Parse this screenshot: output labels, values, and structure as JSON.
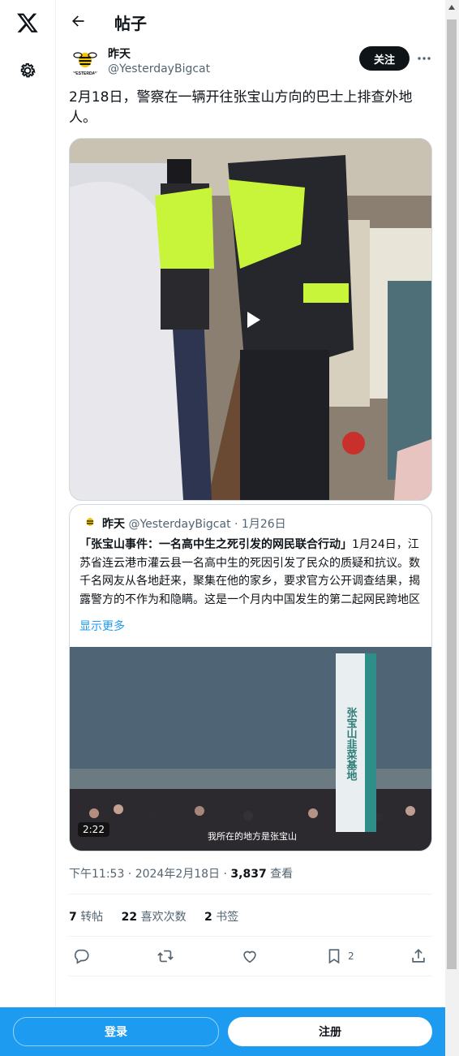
{
  "nav": {
    "logo_icon": "x-logo-icon",
    "settings_icon": "gear-icon"
  },
  "header": {
    "title": "帖子",
    "back_icon": "arrow-left-icon"
  },
  "author": {
    "name": "昨天",
    "handle": "@YesterdayBigcat",
    "avatar_label": "YESTERDAY",
    "follow_label": "关注"
  },
  "tweet": {
    "text": "2月18日，警察在一辆开往张宝山方向的巴士上排查外地人。",
    "timestamp": "下午11:53 · 2024年2月18日 · ",
    "views_count": "3,837",
    "views_label": " 查看"
  },
  "quote": {
    "name": "昨天",
    "meta": "@YesterdayBigcat · 1月26日",
    "title": "「张宝山事件：一名高中生之死引发的网民联合行动」",
    "body": "1月24日，江苏省连云港市灌云县一名高中生的死因引发了民众的质疑和抗议。数千名网友从各地赶来，聚集在他的家乡，要求官方公开调查结果，揭露警方的不作为和隐瞒。这是一个月内中国发生的第二起网民跨地区联合行动，反映了他们对官方的不信任和…",
    "show_more": "显示更多",
    "duration": "2:22",
    "caption": "我所在的地方是张宝山",
    "sign_text": "张宝山韭菜基地"
  },
  "stats": {
    "retweets_count": "7",
    "retweets_label": "转帖",
    "likes_count": "22",
    "likes_label": "喜欢次数",
    "bookmarks_count": "2",
    "bookmarks_label": "书签"
  },
  "actions": {
    "bookmark_count": "2"
  },
  "bottom": {
    "login_label": "登录",
    "signup_label": "注册"
  },
  "colors": {
    "accent": "#1d9bf0",
    "text": "#0f1419",
    "secondary": "#536471",
    "vest": "#c8f53a"
  }
}
